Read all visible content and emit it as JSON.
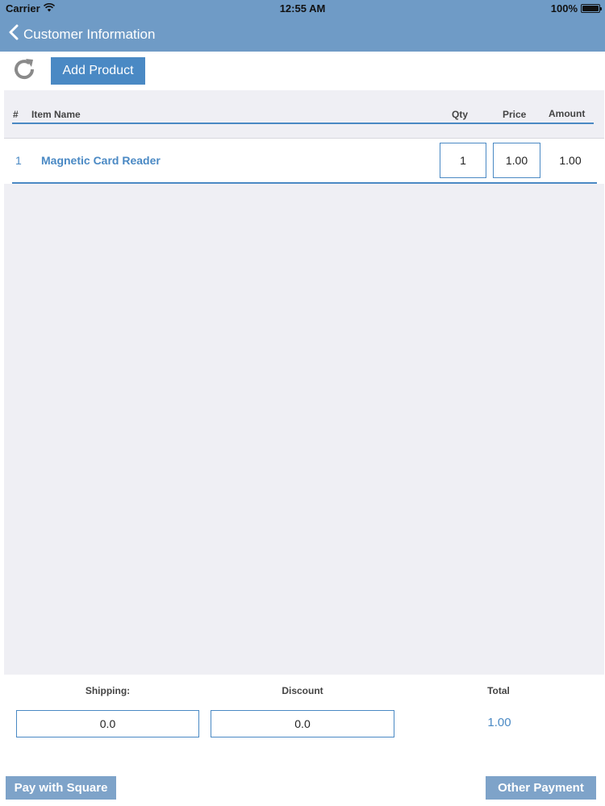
{
  "status_bar": {
    "carrier": "Carrier",
    "time": "12:55 AM",
    "battery": "100%"
  },
  "nav": {
    "back_label": "Customer Information"
  },
  "toolbar": {
    "add_product_label": "Add Product"
  },
  "table": {
    "headers": {
      "num": "#",
      "item_name": "Item Name",
      "qty": "Qty",
      "price": "Price",
      "amount": "Amount"
    },
    "rows": [
      {
        "num": "1",
        "name": "Magnetic Card Reader",
        "qty": "1",
        "price": "1.00",
        "amount": "1.00"
      }
    ]
  },
  "totals": {
    "shipping_label": "Shipping:",
    "shipping_value": "0.0",
    "discount_label": "Discount",
    "discount_value": "0.0",
    "total_label": "Total",
    "total_value": "1.00"
  },
  "actions": {
    "pay_square_label": "Pay with Square",
    "other_payment_label": "Other Payment"
  },
  "colors": {
    "nav_background": "#6f9bc6",
    "accent": "#4a89c4",
    "bottom_button": "#7ea3c9",
    "table_background": "#efeff4"
  },
  "icons": {
    "back": "chevron-left-icon",
    "refresh": "refresh-icon",
    "wifi": "wifi-icon",
    "battery": "battery-icon"
  }
}
